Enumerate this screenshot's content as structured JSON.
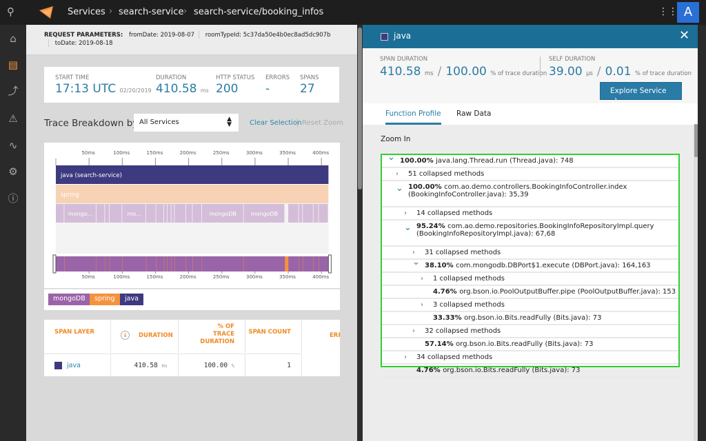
{
  "topbar": {
    "breadcrumbs": [
      "Services",
      "search-service",
      "search-service/booking_infos"
    ],
    "avatar": "A"
  },
  "sidebar": {
    "items": [
      "home-icon",
      "traces-icon",
      "topology-icon",
      "alerts-icon",
      "metrics-icon",
      "settings-icon",
      "help-icon"
    ]
  },
  "request": {
    "label": "REQUEST PARAMETERS:",
    "params": [
      "fromDate: 2019-08-07",
      "roomTypeId: 5c37da50e4b0ec8ad5dc907b",
      "toDate: 2019-08-18"
    ]
  },
  "summary": {
    "start": {
      "label": "START TIME",
      "value": "17:13 UTC",
      "date": "02/20/2019"
    },
    "duration": {
      "label": "DURATION",
      "value": "410.58",
      "unit": "ms"
    },
    "http": {
      "label": "HTTP STATUS",
      "value": "200"
    },
    "errors": {
      "label": "ERRORS",
      "value": "-"
    },
    "spans": {
      "label": "SPANS",
      "value": "27"
    }
  },
  "breakdown": {
    "title": "Trace Breakdown by",
    "select": "All Services",
    "clear": "Clear Selection",
    "reset": "Reset Zoom"
  },
  "timeline": {
    "ticks": [
      "50ms",
      "100ms",
      "150ms",
      "200ms",
      "250ms",
      "300ms",
      "350ms",
      "400ms"
    ],
    "tick_values": [
      50,
      100,
      150,
      200,
      250,
      300,
      350,
      400
    ],
    "total_ms": 410.58,
    "java_label": "java (search-service)",
    "spring_label": "spring",
    "mongo_segments": [
      [
        0,
        12.8,
        ""
      ],
      [
        12.8,
        61,
        "mongo..."
      ],
      [
        61,
        74,
        ""
      ],
      [
        74,
        81,
        ""
      ],
      [
        81,
        100,
        ""
      ],
      [
        100,
        136,
        "mo..."
      ],
      [
        136,
        151,
        ""
      ],
      [
        151,
        163,
        ""
      ],
      [
        163,
        168,
        ""
      ],
      [
        168,
        174,
        ""
      ],
      [
        174,
        179,
        ""
      ],
      [
        179,
        196,
        ""
      ],
      [
        196,
        206,
        ""
      ],
      [
        206,
        220,
        ""
      ],
      [
        220,
        283,
        "mongoDB"
      ],
      [
        283,
        345,
        "mongoDB"
      ],
      [
        350,
        366,
        ""
      ],
      [
        366,
        372,
        ""
      ],
      [
        372,
        388,
        ""
      ],
      [
        388,
        396,
        ""
      ],
      [
        396,
        410.58,
        ""
      ]
    ]
  },
  "legend": [
    {
      "label": "mongoDB",
      "color": "#9a64a8"
    },
    {
      "label": "spring",
      "color": "#f5923e"
    },
    {
      "label": "java",
      "color": "#3d3a80"
    }
  ],
  "table": {
    "headers": [
      "SPAN LAYER",
      "DURATION",
      "% OF TRACE DURATION",
      "SPAN COUNT",
      "ERR"
    ],
    "row": {
      "layer": "java",
      "duration": "410.58",
      "duration_unit": "ms",
      "pct": "100.00",
      "pct_unit": "%",
      "count": "1"
    }
  },
  "panel": {
    "title": "java",
    "span_duration": {
      "label": "SPAN DURATION",
      "value": "410.58",
      "unit": "ms",
      "pct": "100.00",
      "pct_label": "% of trace duration"
    },
    "self_duration": {
      "label": "SELF DURATION",
      "value": "39.00",
      "unit": "µs",
      "pct": "0.01",
      "pct_label": "% of trace duration"
    },
    "explore": "Explore Service",
    "tabs": [
      "Function Profile",
      "Raw Data"
    ],
    "active_tab": "Function Profile",
    "zoom_in": "Zoom In",
    "tree": [
      {
        "depth": 0,
        "state": "expanded",
        "pct": "100.00%",
        "text": "java.lang.Thread.run (Thread.java): 748"
      },
      {
        "depth": 1,
        "state": "collapsed",
        "pct": "",
        "text": "51 collapsed methods"
      },
      {
        "depth": 1,
        "state": "expanded",
        "pct": "100.00%",
        "text": "com.ao.demo.controllers.BookingInfoController.index (BookingInfoController.java): 35,39"
      },
      {
        "depth": 2,
        "state": "collapsed",
        "pct": "",
        "text": "14 collapsed methods"
      },
      {
        "depth": 2,
        "state": "expanded",
        "pct": "95.24%",
        "text": "com.ao.demo.repositories.BookingInfoRepositoryImpl.query (BookingInfoRepositoryImpl.java): 67,68"
      },
      {
        "depth": 3,
        "state": "collapsed",
        "pct": "",
        "text": "31 collapsed methods"
      },
      {
        "depth": 3,
        "state": "expanded",
        "pct": "38.10%",
        "text": "com.mongodb.DBPort$1.execute (DBPort.java): 164,163"
      },
      {
        "depth": 4,
        "state": "collapsed",
        "pct": "",
        "text": "1 collapsed methods"
      },
      {
        "depth": 4,
        "state": "leaf",
        "pct": "4.76%",
        "text": "org.bson.io.PoolOutputBuffer.pipe (PoolOutputBuffer.java): 153"
      },
      {
        "depth": 4,
        "state": "collapsed",
        "pct": "",
        "text": "3 collapsed methods"
      },
      {
        "depth": 4,
        "state": "leaf",
        "pct": "33.33%",
        "text": "org.bson.io.Bits.readFully (Bits.java): 73"
      },
      {
        "depth": 3,
        "state": "collapsed",
        "pct": "",
        "text": "32 collapsed methods"
      },
      {
        "depth": 3,
        "state": "leaf",
        "pct": "57.14%",
        "text": "org.bson.io.Bits.readFully (Bits.java): 73"
      },
      {
        "depth": 2,
        "state": "collapsed",
        "pct": "",
        "text": "34 collapsed methods"
      },
      {
        "depth": 2,
        "state": "leaf",
        "pct": "4.76%",
        "text": "org.bson.io.Bits.readFully (Bits.java): 73"
      }
    ]
  },
  "colors": {
    "accent": "#2a7ba6",
    "header": "#1b6e96",
    "highlight": "#2ed12e",
    "java": "#3d3a80",
    "spring": "#f5923e",
    "spring_light": "#f7d2b5",
    "mongo": "#9a64a8",
    "mongo_light": "#d4bdd8"
  }
}
